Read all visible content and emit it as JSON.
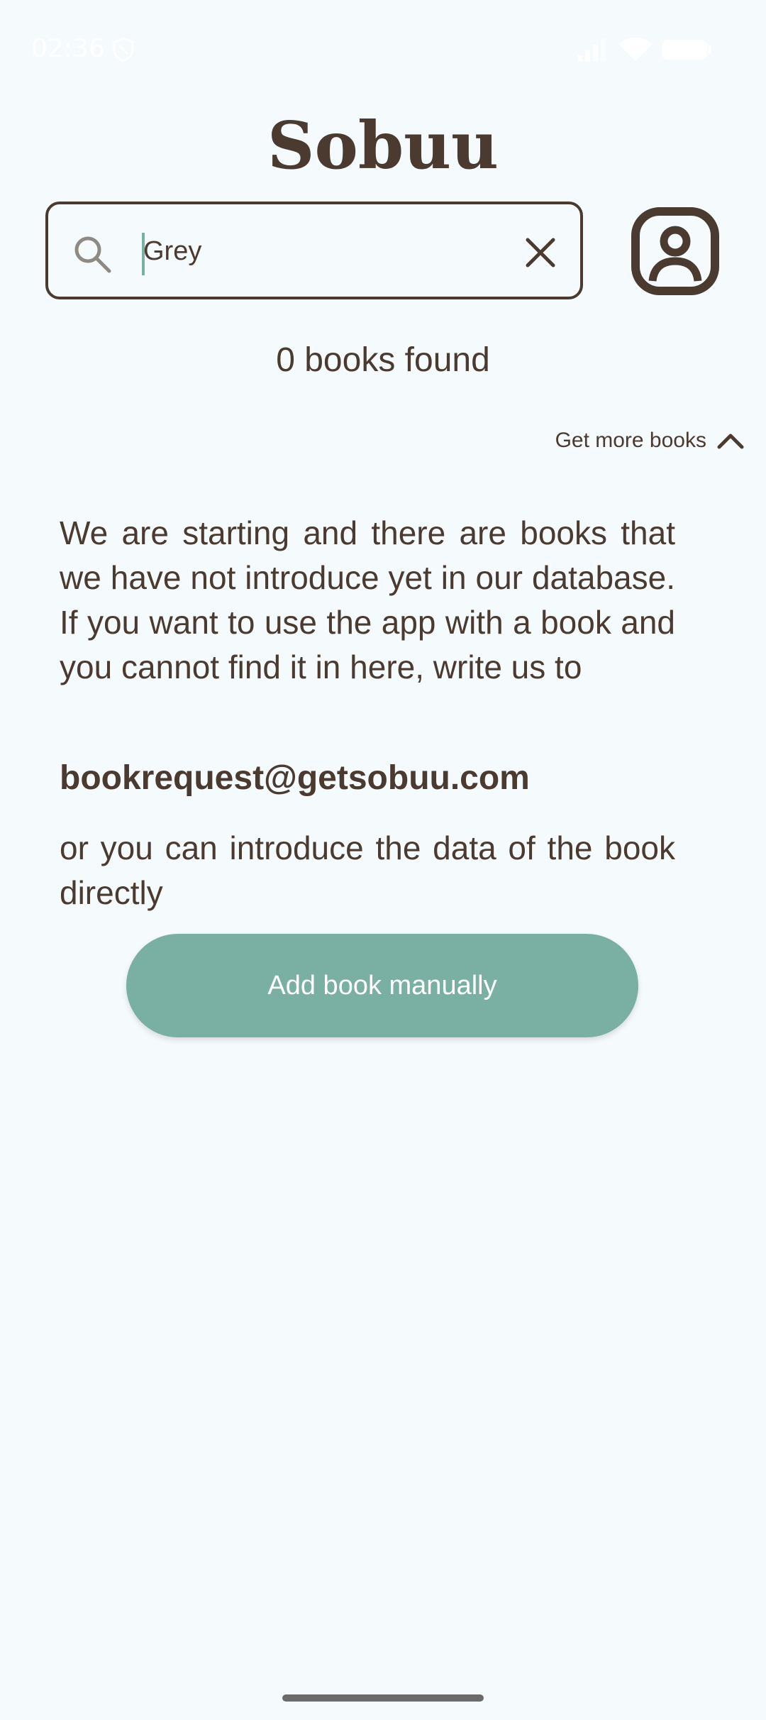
{
  "status_bar": {
    "time": "02:36",
    "icons": [
      "shield-icon",
      "signal-icon",
      "wifi-icon",
      "battery-icon"
    ]
  },
  "app": {
    "title": "Sobuu"
  },
  "search": {
    "value": "Grey",
    "icons": {
      "leading": "search-icon",
      "trailing": "close-icon"
    }
  },
  "profile": {
    "icon": "user-profile-icon"
  },
  "results": {
    "count_text": "0 books found"
  },
  "more_books": {
    "label": "Get more books",
    "icon": "chevron-up-icon"
  },
  "info": {
    "paragraph1": "We are starting and there are books that we have not introduce yet in our database. If you want to use the app with a book and you cannot find it in here, write us to",
    "email": "bookrequest@getsobuu.com",
    "paragraph2": "or you can introduce the data of the book directly"
  },
  "actions": {
    "add_manually_label": "Add book manually"
  },
  "colors": {
    "background": "#F5FAFD",
    "text": "#4A3A30",
    "accent": "#7AB0A4",
    "button_text": "#FFFFFF"
  }
}
